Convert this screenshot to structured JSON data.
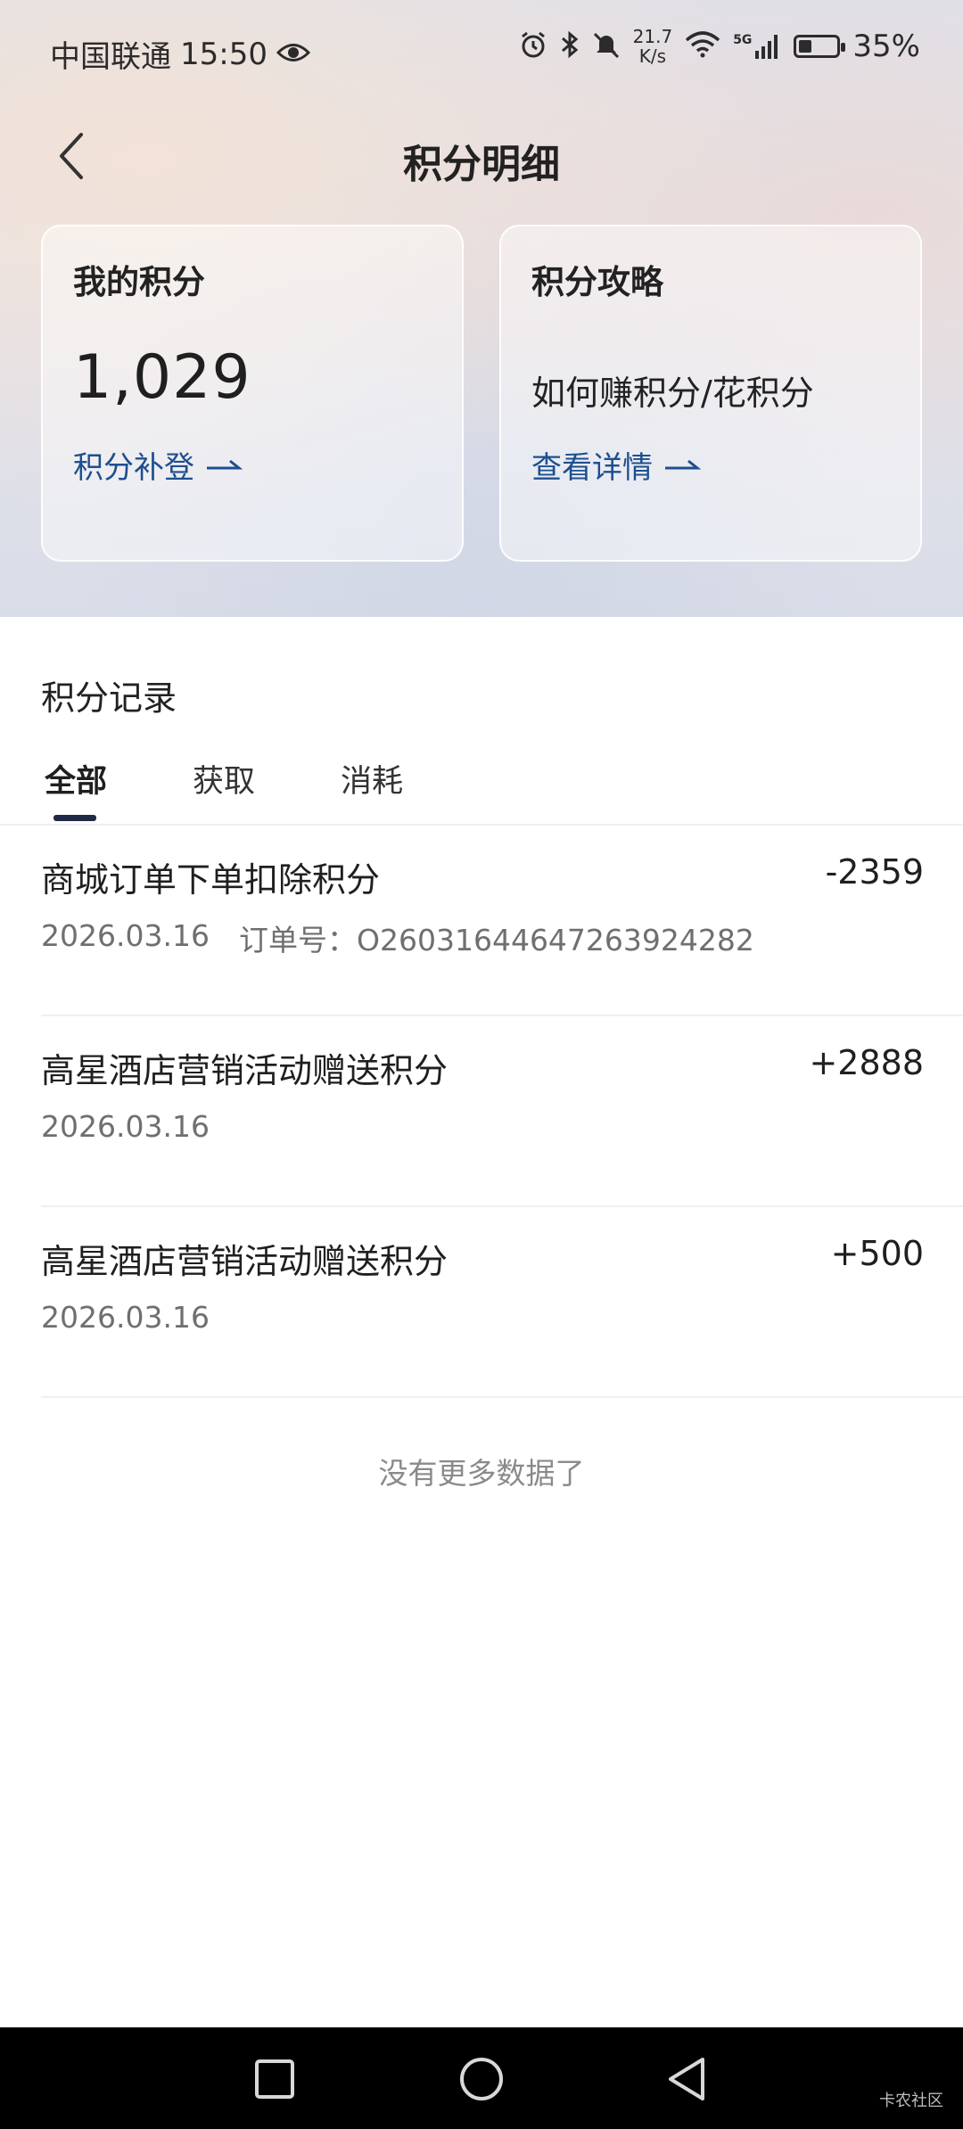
{
  "status_bar": {
    "carrier": "中国联通",
    "time": "15:50",
    "net_speed_value": "21.7",
    "net_speed_unit": "K/s",
    "signal_label": "5G",
    "battery_percent": "35%",
    "battery_level": 0.35,
    "icons": [
      "eye-icon",
      "alarm-icon",
      "bluetooth-icon",
      "mute-icon",
      "wifi-icon",
      "signal-icon",
      "battery-icon"
    ]
  },
  "header": {
    "title": "积分明细",
    "back_icon": "chevron-left-icon"
  },
  "cards": {
    "my_points": {
      "title": "我的积分",
      "value": "1,029",
      "link": "积分补登"
    },
    "guide": {
      "title": "积分攻略",
      "subtitle": "如何赚积分/花积分",
      "link": "查看详情"
    }
  },
  "records": {
    "section_title": "积分记录",
    "tabs": [
      {
        "label": "全部",
        "active": true
      },
      {
        "label": "获取",
        "active": false
      },
      {
        "label": "消耗",
        "active": false
      }
    ],
    "items": [
      {
        "title": "商城订单下单扣除积分",
        "amount": "-2359",
        "date": "2026.03.16",
        "order": "订单号：O26031644647263924282"
      },
      {
        "title": "高星酒店营销活动赠送积分",
        "amount": "+2888",
        "date": "2026.03.16"
      },
      {
        "title": "高星酒店营销活动赠送积分",
        "amount": "+500",
        "date": "2026.03.16"
      }
    ],
    "no_more": "没有更多数据了"
  },
  "watermark": "卡农社区",
  "colors": {
    "link": "#1e4f8f",
    "tab_indicator": "#1f2a44"
  }
}
